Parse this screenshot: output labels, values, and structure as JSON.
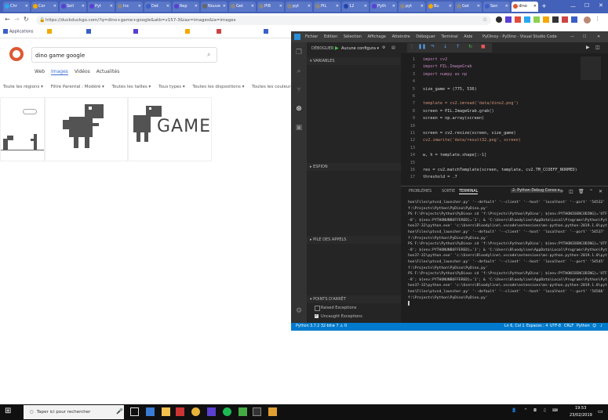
{
  "browser": {
    "tabs": [
      {
        "label": "Chr",
        "color": "#2aa7f0"
      },
      {
        "label": "Cor",
        "color": "#f2a900"
      },
      {
        "label": "Sell",
        "color": "#5a3fd1"
      },
      {
        "label": "Pyt",
        "color": "#5a3fd1"
      },
      {
        "label": "Inc",
        "color": "#888888"
      },
      {
        "label": "Det",
        "color": "#3b5fc7"
      },
      {
        "label": "Rep",
        "color": "#5a3fd1"
      },
      {
        "label": "Nouve",
        "color": "#666666"
      },
      {
        "label": "Get",
        "color": "#888888"
      },
      {
        "label": "PIB",
        "color": "#888888"
      },
      {
        "label": "pyt",
        "color": "#888888"
      },
      {
        "label": "PIL",
        "color": "#888888"
      },
      {
        "label": "12",
        "color": "#2244aa"
      },
      {
        "label": "Pyth",
        "color": "#5a3fd1"
      },
      {
        "label": "pyt",
        "color": "#888888"
      },
      {
        "label": "Bu",
        "color": "#f2a900"
      },
      {
        "label": "Get",
        "color": "#888888"
      },
      {
        "label": "Sen",
        "color": "#3b5fc7"
      },
      {
        "label": "dino",
        "color": "#de5833",
        "active": true
      }
    ],
    "url": "https://duckduckgo.com/?q=dino+game+google&atb=v157-3&iax=images&ia=images",
    "bookmarks": [
      "Applications",
      "",
      "",
      "",
      "",
      "",
      "",
      ""
    ]
  },
  "ddg": {
    "query": "dino game google",
    "nav": [
      "Web",
      "Images",
      "Vidéos",
      "Actualités"
    ],
    "filters": [
      "Toute les régions ▾",
      "Filtre Parental : Modéré ▾",
      "Toutes les tailles ▾",
      "Tous types ▾",
      "Toutes les dispositions ▾",
      "Toutes les couleurs ▾"
    ],
    "game_text": "GAME"
  },
  "vscode": {
    "menu": [
      "Fichier",
      "Edition",
      "Sélection",
      "Affichage",
      "Atteindre",
      "Déboguer",
      "Terminal",
      "Aide"
    ],
    "title": "PyDinoy - PyDino - Visual Studio Code",
    "debug_label": "DÉBOGUER",
    "debug_config": "Aucune configura ▾",
    "sections": [
      "▾ VARIABLES",
      "▸ ESPION",
      "▸ PILE DES APPELS",
      "▾ POINTS D'ARRÊT"
    ],
    "breakpoints": [
      "Raised Exceptions",
      "Uncaught Exceptions"
    ],
    "code_lines": [
      "import cv2",
      "import PIL.ImageGrab",
      "import numpy as np",
      "",
      "size_game = (775, 536)",
      "",
      "template = cv2.imread('data/dino2.png')",
      "screen = PIL.ImageGrab.grab()",
      "screen = np.array(screen)",
      "",
      "screen = cv2.resize(screen, size_game)",
      "cv2.imwrite('data/result32.png', screen)",
      "",
      "w, h = template.shape[:-1]",
      "",
      "res = cv2.matchTemplate(screen, template, cv2.TM_CCOEFF_NORMED)",
      "threshold = .7"
    ],
    "panel_tabs": [
      "PROBLÈMES",
      "SORTIE",
      "TERMINAL"
    ],
    "terminal_select": "2: Python Debug Conso ▾",
    "terminal_lines": [
      "hon\\Files\\ptvsd_launcher.py' '--default' '--client' '--host' 'localhost' '--port' '54532' 'F",
      "f:\\Projects\\Python\\PyDino\\PyDino.py'",
      "PS F:\\Projects\\Python\\PyDino> cd 'f:\\Projects\\Python\\PyDino'; ${env:PYTHONIOENCODING}='UTF",
      "-8'; ${env:PYTHONUNBUFFERED}='1'; & 'C:\\Users\\Bloodyline\\AppData\\Local\\Programs\\Python\\Pyt",
      "hon37-32\\python.exe' 'c:\\Users\\Bloodyline\\.vscode\\extensions\\ms-python.python-2019.1.0\\pyt",
      "hon\\Files\\ptvsd_launcher.py' '--default' '--client' '--host' 'localhost' '--port' '54537' 'F",
      "f:\\Projects\\Python\\PyDino\\PyDino.py'",
      "PS F:\\Projects\\Python\\PyDino> cd 'f:\\Projects\\Python\\PyDino'; ${env:PYTHONIOENCODING}='UTF",
      "-8'; ${env:PYTHONUNBUFFERED}='1'; & 'C:\\Users\\Bloodyline\\AppData\\Local\\Programs\\Python\\Pyt",
      "hon37-32\\python.exe' 'c:\\Users\\Bloodyline\\.vscode\\extensions\\ms-python.python-2019.1.0\\pyt",
      "hon\\Files\\ptvsd_launcher.py' '--default' '--client' '--host' 'localhost' '--port' '54545' 'F",
      "f:\\Projects\\Python\\PyDino\\PyDino.py'",
      "PS F:\\Projects\\Python\\PyDino> cd 'f:\\Projects\\Python\\PyDino'; ${env:PYTHONIOENCODING}='UTF",
      "-8'; ${env:PYTHONUNBUFFERED}='1'; & 'C:\\Users\\Bloodyline\\AppData\\Local\\Programs\\Python\\Pyt",
      "hon37-32\\python.exe' 'c:\\Users\\Bloodyline\\.vscode\\extensions\\ms-python.python-2019.1.0\\pyt",
      "hon\\Files\\ptvsd_launcher.py' '--default' '--client' '--host' 'localhost' '--port' '54566' 'F",
      "f:\\Projects\\Python\\PyDino\\PyDino.py'"
    ],
    "status_left": "Python 3.7.2 32-bit",
    "status_problems": "⊗ 7 ⚠ 0",
    "status_right": [
      "Ln 6, Col 1",
      "Espaces : 4",
      "UTF-8",
      "CRLF",
      "Python"
    ]
  },
  "taskbar": {
    "search_placeholder": "Taper ici pour rechercher",
    "time": "19:53",
    "date": "23/02/2019"
  },
  "colors": {
    "vscode_blue": "#007acc",
    "ddg_orange": "#de5833",
    "browser_blue": "#4361b8"
  }
}
